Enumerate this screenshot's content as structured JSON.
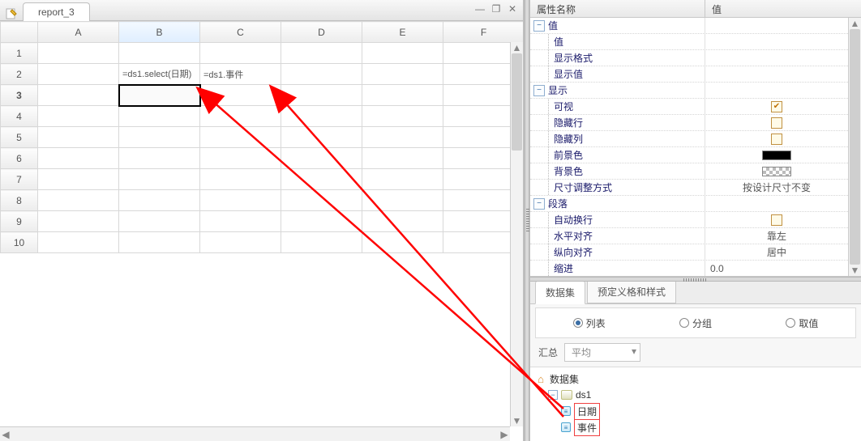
{
  "tab": {
    "title": "report_3"
  },
  "sheet": {
    "cols": [
      "A",
      "B",
      "C",
      "D",
      "E",
      "F"
    ],
    "rows": [
      "1",
      "2",
      "3",
      "4",
      "5",
      "6",
      "7",
      "8",
      "9",
      "10"
    ],
    "selected_col": "B",
    "selected_row": "3",
    "cells": {
      "B2": "=ds1.select(日期)",
      "C2": "=ds1.事件"
    }
  },
  "props": {
    "header_name": "属性名称",
    "header_value": "值",
    "groups": [
      {
        "kind": "group",
        "label": "值"
      },
      {
        "kind": "item",
        "label": "值",
        "value": ""
      },
      {
        "kind": "item",
        "label": "显示格式",
        "value": ""
      },
      {
        "kind": "item",
        "label": "显示值",
        "value": ""
      },
      {
        "kind": "group",
        "label": "显示"
      },
      {
        "kind": "item",
        "label": "可视",
        "value_type": "check",
        "checked": true
      },
      {
        "kind": "item",
        "label": "隐藏行",
        "value_type": "check",
        "checked": false
      },
      {
        "kind": "item",
        "label": "隐藏列",
        "value_type": "check",
        "checked": false
      },
      {
        "kind": "item",
        "label": "前景色",
        "value_type": "swatch_black"
      },
      {
        "kind": "item",
        "label": "背景色",
        "value_type": "swatch_checker"
      },
      {
        "kind": "item",
        "label": "尺寸调整方式",
        "value": "按设计尺寸不变"
      },
      {
        "kind": "group",
        "label": "段落"
      },
      {
        "kind": "item",
        "label": "自动换行",
        "value_type": "check",
        "checked": false
      },
      {
        "kind": "item",
        "label": "水平对齐",
        "value": "靠左"
      },
      {
        "kind": "item",
        "label": "纵向对齐",
        "value": "居中"
      },
      {
        "kind": "item",
        "label": "缩进",
        "value": "0.0",
        "align": "left"
      }
    ]
  },
  "lower": {
    "tabs": {
      "dataset": "数据集",
      "predef": "预定义格和样式"
    },
    "radios": {
      "list": "列表",
      "group": "分组",
      "value": "取值"
    },
    "agg_label": "汇总",
    "agg_value": "平均",
    "tree": {
      "root": "数据集",
      "ds": "ds1",
      "cols": [
        "日期",
        "事件"
      ]
    }
  }
}
